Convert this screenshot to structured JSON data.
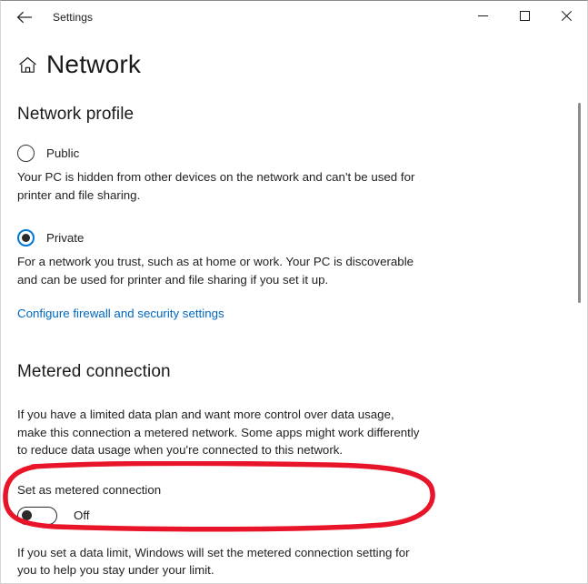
{
  "titlebar": {
    "back_label": "Back",
    "app_title": "Settings",
    "minimize_label": "Minimize",
    "maximize_label": "Maximize",
    "close_label": "Close"
  },
  "header": {
    "home_icon": "home-icon",
    "page_title": "Network"
  },
  "network_profile": {
    "heading": "Network profile",
    "options": [
      {
        "label": "Public",
        "selected": false,
        "description": "Your PC is hidden from other devices on the network and can't be used for printer and file sharing."
      },
      {
        "label": "Private",
        "selected": true,
        "description": "For a network you trust, such as at home or work. Your PC is discoverable and can be used for printer and file sharing if you set it up."
      }
    ],
    "link": "Configure firewall and security settings"
  },
  "metered_connection": {
    "heading": "Metered connection",
    "description": "If you have a limited data plan and want more control over data usage, make this connection a metered network. Some apps might work differently to reduce data usage when you're connected to this network.",
    "toggle": {
      "caption": "Set as metered connection",
      "state": "Off",
      "checked": false
    },
    "footnote": "If you set a data limit, Windows will set the metered connection setting for you to help you stay under your limit."
  },
  "annotation": {
    "shape": "ellipse",
    "color": "#e8152a",
    "target": "Set as metered connection"
  },
  "colors": {
    "accent": "#0078d7",
    "link": "#0067c0",
    "text": "#1f1f1f",
    "annotation_red": "#e8152a"
  },
  "scrollbar": {
    "name": "vertical-scrollbar"
  }
}
